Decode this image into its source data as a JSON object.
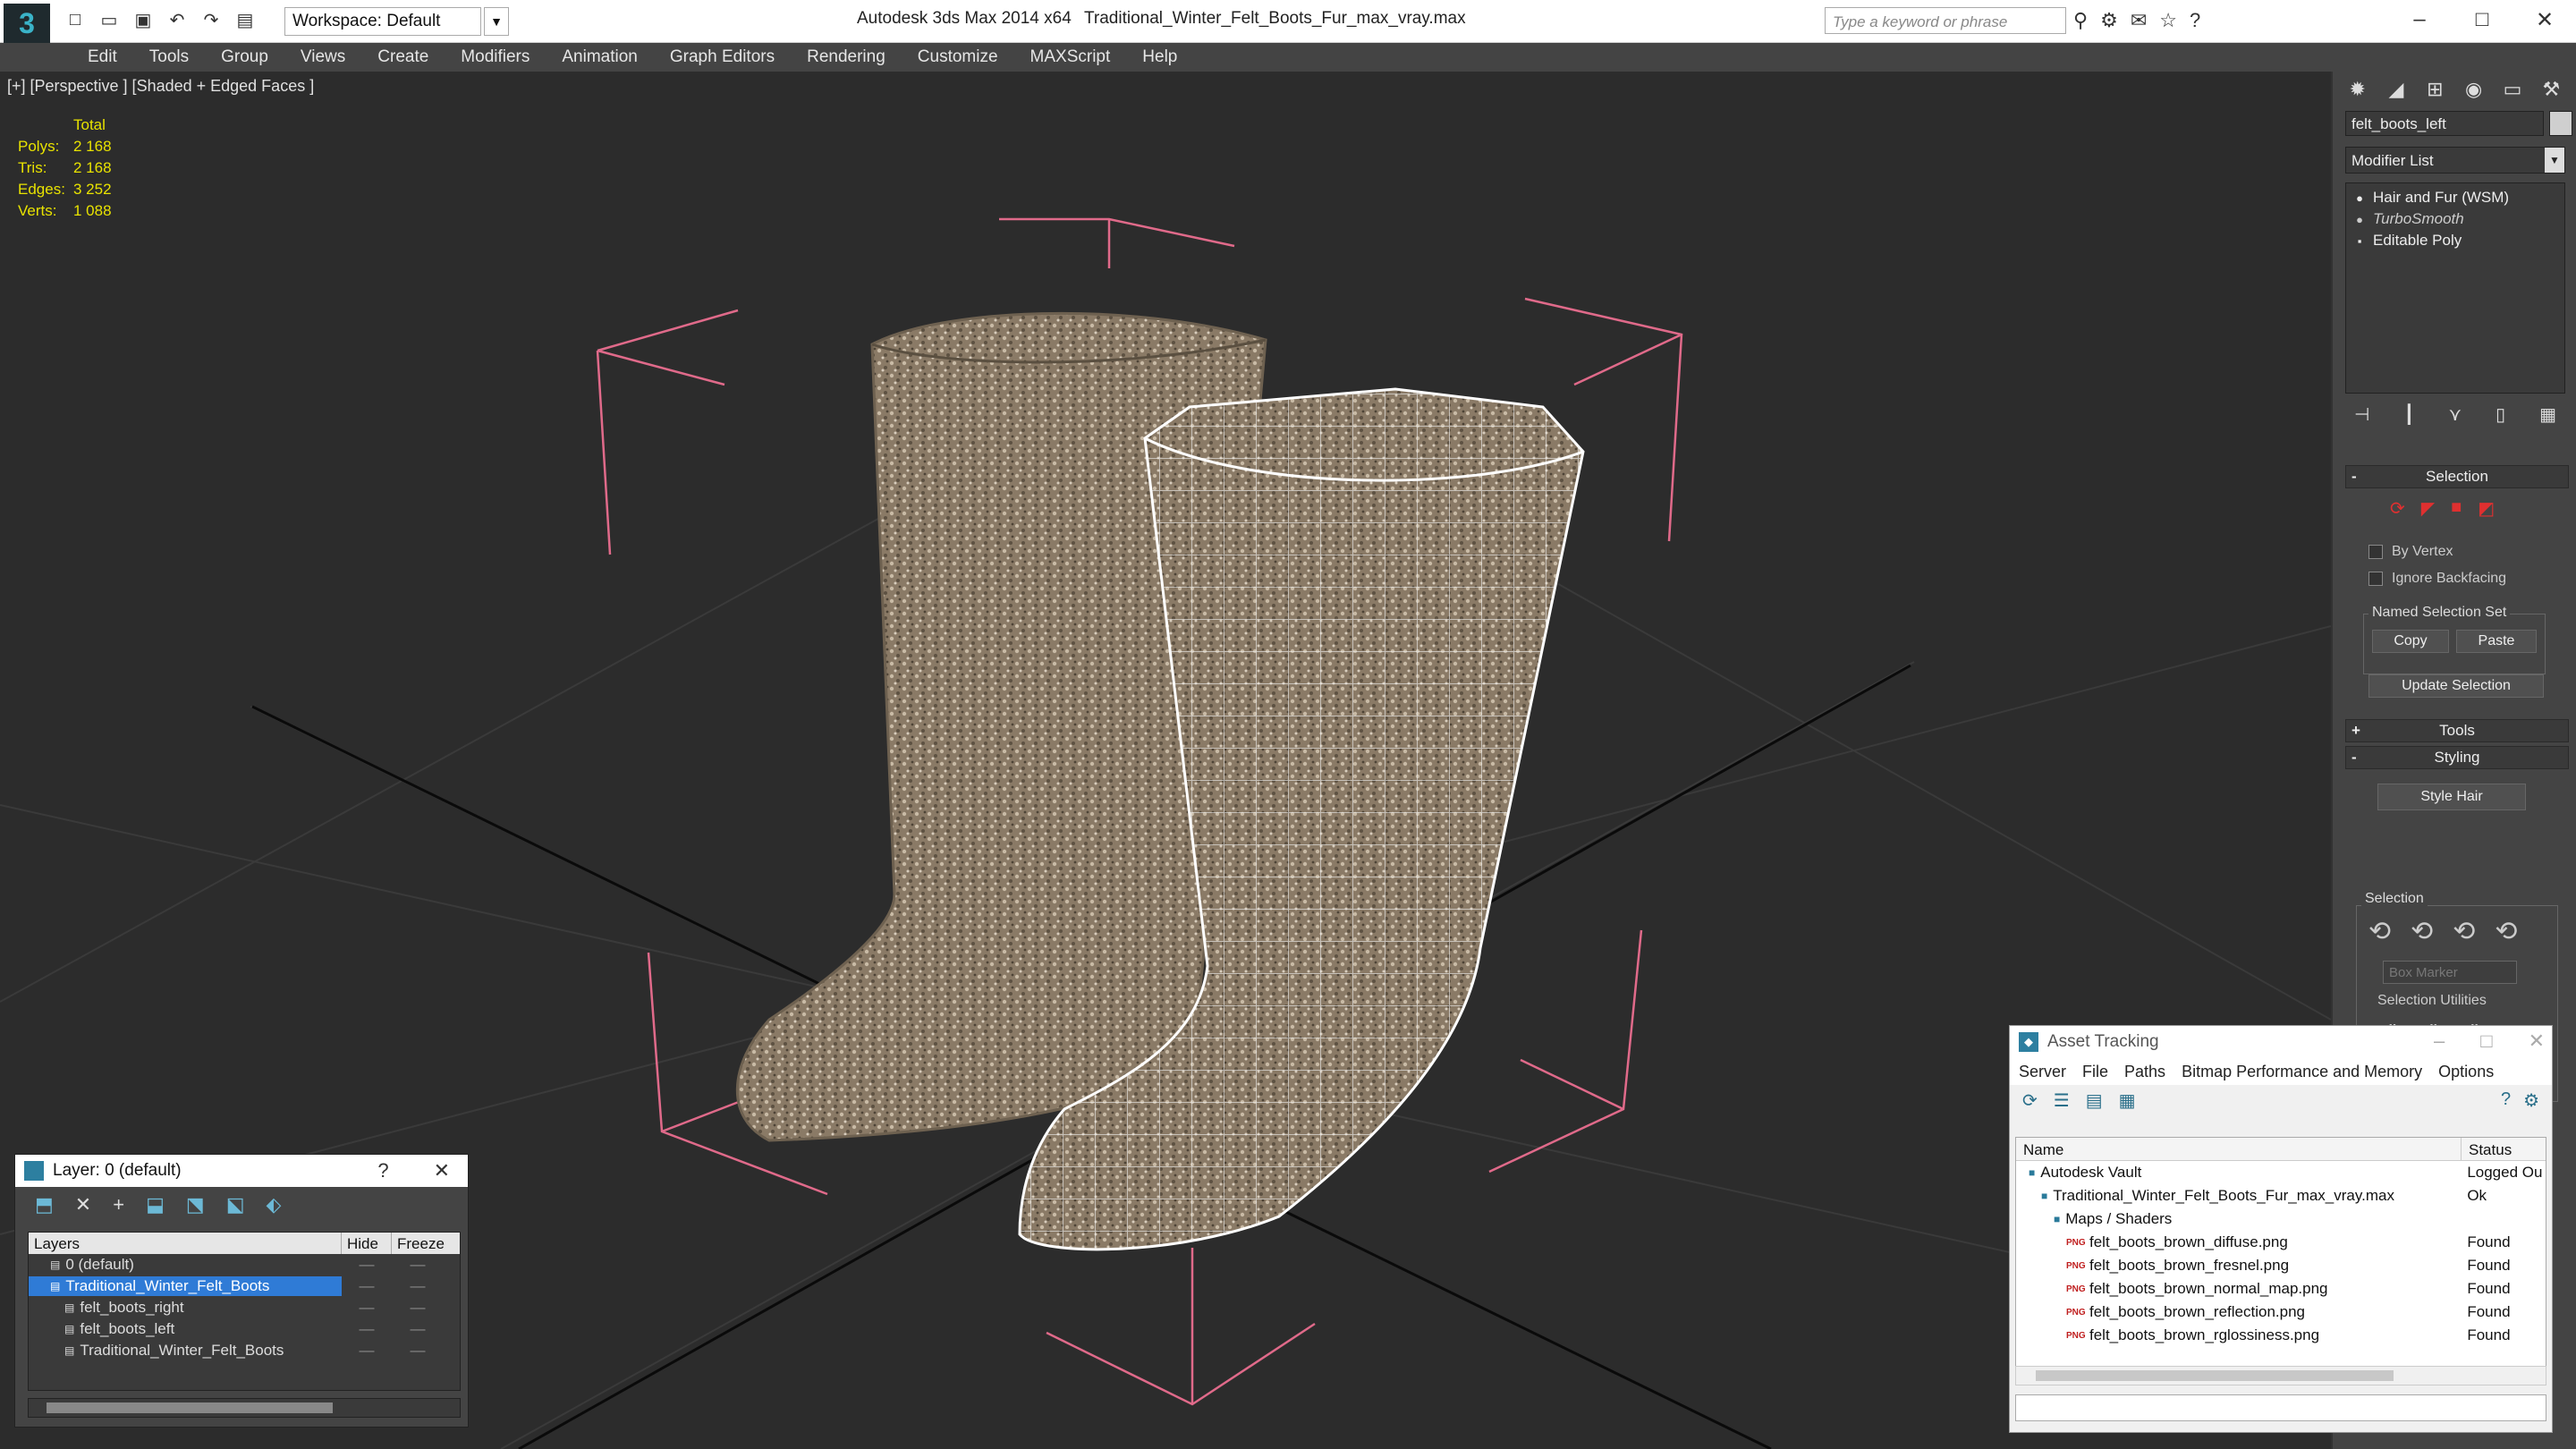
{
  "titlebar": {
    "workspace": "Workspace: Default",
    "app_title": "Autodesk 3ds Max  2014 x64",
    "file_title": "Traditional_Winter_Felt_Boots_Fur_max_vray.max",
    "search_placeholder": "Type a keyword or phrase"
  },
  "menu": [
    "Edit",
    "Tools",
    "Group",
    "Views",
    "Create",
    "Modifiers",
    "Animation",
    "Graph Editors",
    "Rendering",
    "Customize",
    "MAXScript",
    "Help"
  ],
  "viewport": {
    "label": "[+] [Perspective ] [Shaded + Edged Faces ]",
    "stats_header": "Total",
    "stats": [
      {
        "k": "Polys:",
        "v": "2 168"
      },
      {
        "k": "Tris:",
        "v": "2 168"
      },
      {
        "k": "Edges:",
        "v": "3 252"
      },
      {
        "k": "Verts:",
        "v": "1 088"
      }
    ]
  },
  "command_panel": {
    "object_name": "felt_boots_left",
    "modifier_list": "Modifier List",
    "stack": [
      "Hair and Fur (WSM)",
      "TurboSmooth",
      "Editable Poly"
    ],
    "selection_title": "Selection",
    "by_vertex": "By Vertex",
    "ignore_backfacing": "Ignore Backfacing",
    "named_sel_set": "Named Selection Set",
    "copy": "Copy",
    "paste": "Paste",
    "update_selection": "Update Selection",
    "tools_title": "Tools",
    "styling_title": "Styling",
    "style_hair": "Style Hair",
    "styling_selection": "Selection",
    "box_marker": "Box Marker",
    "selection_utilities": "Selection Utilities",
    "plus": "+",
    "minus": "-"
  },
  "asset_tracking": {
    "title": "Asset Tracking",
    "menu": [
      "Server",
      "File",
      "Paths",
      "Bitmap Performance and Memory",
      "Options"
    ],
    "col_name": "Name",
    "col_status": "Status",
    "rows": [
      {
        "name": "Autodesk Vault",
        "status": "Logged Ou",
        "indent": 1
      },
      {
        "name": "Traditional_Winter_Felt_Boots_Fur_max_vray.max",
        "status": "Ok",
        "indent": 2
      },
      {
        "name": "Maps / Shaders",
        "status": "",
        "indent": 3
      },
      {
        "name": "felt_boots_brown_diffuse.png",
        "status": "Found",
        "indent": 4
      },
      {
        "name": "felt_boots_brown_fresnel.png",
        "status": "Found",
        "indent": 4
      },
      {
        "name": "felt_boots_brown_normal_map.png",
        "status": "Found",
        "indent": 4
      },
      {
        "name": "felt_boots_brown_reflection.png",
        "status": "Found",
        "indent": 4
      },
      {
        "name": "felt_boots_brown_rglossiness.png",
        "status": "Found",
        "indent": 4
      }
    ],
    "png": "PNG"
  },
  "layer_window": {
    "title": "Layer: 0 (default)",
    "help": "?",
    "col_layers": "Layers",
    "col_hide": "Hide",
    "col_freeze": "Freeze",
    "rows": [
      {
        "name": "0 (default)",
        "indent": 1
      },
      {
        "name": "Traditional_Winter_Felt_Boots",
        "indent": 1,
        "selected": true
      },
      {
        "name": "felt_boots_right",
        "indent": 2
      },
      {
        "name": "felt_boots_left",
        "indent": 2
      },
      {
        "name": "Traditional_Winter_Felt_Boots",
        "indent": 2
      }
    ]
  }
}
